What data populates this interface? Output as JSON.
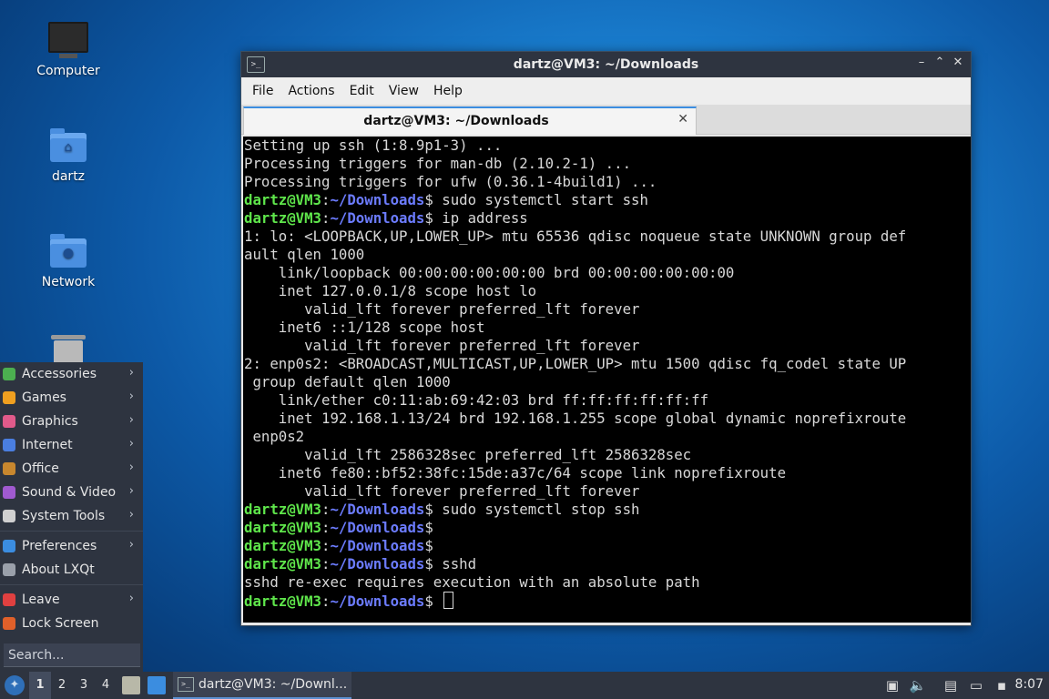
{
  "desktop": {
    "icons": [
      {
        "label": "Computer"
      },
      {
        "label": "dartz"
      },
      {
        "label": "Network"
      }
    ]
  },
  "window": {
    "title": "dartz@VM3: ~/Downloads",
    "menu": [
      "File",
      "Actions",
      "Edit",
      "View",
      "Help"
    ],
    "tab_label": "dartz@VM3: ~/Downloads"
  },
  "terminal": {
    "prompt_user": "dartz@VM3",
    "prompt_path": "~/Downloads",
    "lines": [
      {
        "text": "Setting up ssh (1:8.9p1-3) ..."
      },
      {
        "text": "Processing triggers for man-db (2.10.2-1) ..."
      },
      {
        "text": "Processing triggers for ufw (0.36.1-4build1) ..."
      },
      {
        "cmd": " sudo systemctl start ssh"
      },
      {
        "cmd": " ip address"
      },
      {
        "text": "1: lo: <LOOPBACK,UP,LOWER_UP> mtu 65536 qdisc noqueue state UNKNOWN group def"
      },
      {
        "text": "ault qlen 1000"
      },
      {
        "text": "    link/loopback 00:00:00:00:00:00 brd 00:00:00:00:00:00"
      },
      {
        "text": "    inet 127.0.0.1/8 scope host lo"
      },
      {
        "text": "       valid_lft forever preferred_lft forever"
      },
      {
        "text": "    inet6 ::1/128 scope host"
      },
      {
        "text": "       valid_lft forever preferred_lft forever"
      },
      {
        "text": "2: enp0s2: <BROADCAST,MULTICAST,UP,LOWER_UP> mtu 1500 qdisc fq_codel state UP"
      },
      {
        "text": " group default qlen 1000"
      },
      {
        "text": "    link/ether c0:11:ab:69:42:03 brd ff:ff:ff:ff:ff:ff"
      },
      {
        "text": "    inet 192.168.1.13/24 brd 192.168.1.255 scope global dynamic noprefixroute"
      },
      {
        "text": " enp0s2"
      },
      {
        "text": "       valid_lft 2586328sec preferred_lft 2586328sec"
      },
      {
        "text": "    inet6 fe80::bf52:38fc:15de:a37c/64 scope link noprefixroute"
      },
      {
        "text": "       valid_lft forever preferred_lft forever"
      },
      {
        "cmd": " sudo systemctl stop ssh"
      },
      {
        "cmd": ""
      },
      {
        "cmd": ""
      },
      {
        "cmd": " sshd"
      },
      {
        "text": "sshd re-exec requires execution with an absolute path"
      },
      {
        "cmd": " ",
        "cursor": true
      }
    ]
  },
  "start_menu": {
    "items": [
      {
        "label": "Accessories",
        "icon": "accessories-icon",
        "color": "#4caf50",
        "submenu": true
      },
      {
        "label": "Games",
        "icon": "games-icon",
        "color": "#f0a020",
        "submenu": true
      },
      {
        "label": "Graphics",
        "icon": "graphics-icon",
        "color": "#e05a8a",
        "submenu": true
      },
      {
        "label": "Internet",
        "icon": "internet-icon",
        "color": "#4a7ee0",
        "submenu": true
      },
      {
        "label": "Office",
        "icon": "office-icon",
        "color": "#c8872e",
        "submenu": true
      },
      {
        "label": "Sound & Video",
        "icon": "sound-video-icon",
        "color": "#a05ad0",
        "submenu": true
      },
      {
        "label": "System Tools",
        "icon": "system-tools-icon",
        "color": "#d0d0d0",
        "submenu": true
      },
      {
        "sep": true
      },
      {
        "label": "Preferences",
        "icon": "preferences-icon",
        "color": "#3b8de0",
        "submenu": true
      },
      {
        "label": "About LXQt",
        "icon": "about-icon",
        "color": "#9aa0aa",
        "submenu": false
      },
      {
        "sep": true
      },
      {
        "label": "Leave",
        "icon": "leave-icon",
        "color": "#e04040",
        "submenu": true
      },
      {
        "label": "Lock Screen",
        "icon": "lock-icon",
        "color": "#e0602a",
        "submenu": false
      }
    ],
    "search_placeholder": "Search..."
  },
  "taskbar": {
    "workspaces": [
      "1",
      "2",
      "3",
      "4"
    ],
    "active_workspace": "1",
    "task_label": "dartz@VM3: ~/Downl...",
    "clock": "8:07"
  }
}
